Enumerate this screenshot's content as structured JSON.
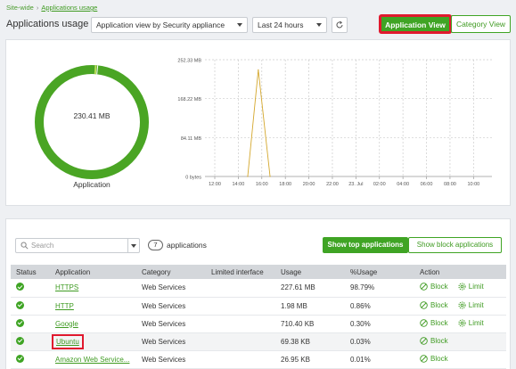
{
  "breadcrumb": {
    "root": "Site-wide",
    "current": "Applications usage"
  },
  "page_title": "Applications usage",
  "filters": {
    "view_select": "Application view by Security appliance",
    "time_select": "Last 24 hours"
  },
  "view_buttons": {
    "application": "Application View",
    "category": "Category View"
  },
  "summary": {
    "total_usage": "230.41 MB",
    "donut_caption": "Application",
    "accent_color": "#4aa524"
  },
  "chart_data": {
    "type": "line",
    "title": "",
    "xlabel": "",
    "ylabel": "",
    "x": [
      "12:00",
      "14:00",
      "16:00",
      "18:00",
      "20:00",
      "22:00",
      "23. Jul",
      "02:00",
      "04:00",
      "06:00",
      "08:00",
      "10:00"
    ],
    "y_ticks": [
      "0 bytes",
      "84.11 MB",
      "168.22 MB",
      "252.33 MB"
    ],
    "ylim": [
      0,
      252.33
    ],
    "y_unit": "MB",
    "series": [
      {
        "points": [
          [
            14.8,
            0
          ],
          [
            15.7,
            230.41
          ],
          [
            16.7,
            0
          ]
        ],
        "color": "#d4a72c"
      }
    ],
    "grid": true
  },
  "table_controls": {
    "search_placeholder": "Search",
    "app_count": "7",
    "app_count_label": "applications",
    "show_top": "Show top applications",
    "show_block": "Show block applications"
  },
  "table": {
    "headers": [
      "Status",
      "Application",
      "Category",
      "Limited interface",
      "Usage",
      "%Usage",
      "Action"
    ],
    "rows": [
      {
        "application": "HTTPS",
        "category": "Web Services",
        "limited": "",
        "usage": "227.61 MB",
        "pct": "98.79%",
        "block": "Block",
        "limit": "Limit"
      },
      {
        "application": "HTTP",
        "category": "Web Services",
        "limited": "",
        "usage": "1.98 MB",
        "pct": "0.86%",
        "block": "Block",
        "limit": "Limit"
      },
      {
        "application": "Google",
        "category": "Web Services",
        "limited": "",
        "usage": "710.40 KB",
        "pct": "0.30%",
        "block": "Block",
        "limit": "Limit"
      },
      {
        "application": "Ubuntu",
        "category": "Web Services",
        "limited": "",
        "usage": "69.38 KB",
        "pct": "0.03%",
        "block": "Block",
        "limit": ""
      },
      {
        "application": "Amazon Web Service...",
        "category": "Web Services",
        "limited": "",
        "usage": "26.95 KB",
        "pct": "0.01%",
        "block": "Block",
        "limit": ""
      }
    ]
  }
}
